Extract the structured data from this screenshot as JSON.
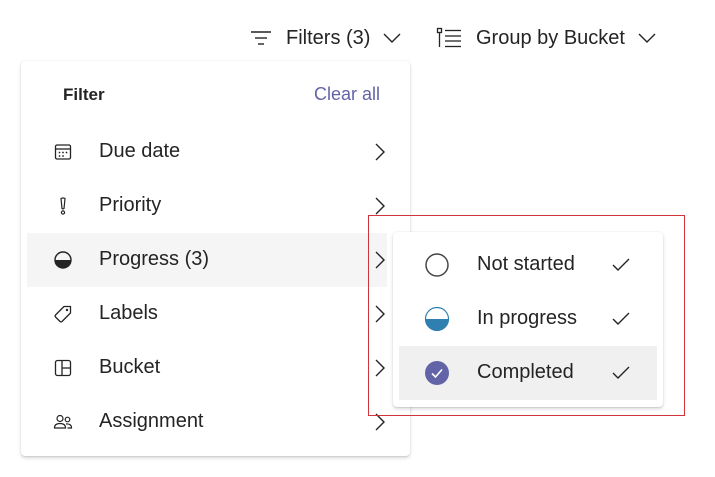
{
  "toolbar": {
    "filters_label": "Filters (3)",
    "group_label": "Group by Bucket"
  },
  "filter_menu": {
    "title": "Filter",
    "clear_all": "Clear all",
    "items": [
      {
        "label": "Due date",
        "icon": "calendar-icon"
      },
      {
        "label": "Priority",
        "icon": "exclamation-icon"
      },
      {
        "label": "Progress (3)",
        "icon": "half-circle-icon",
        "selected": true
      },
      {
        "label": "Labels",
        "icon": "tag-icon"
      },
      {
        "label": "Bucket",
        "icon": "bucket-board-icon"
      },
      {
        "label": "Assignment",
        "icon": "people-icon"
      }
    ]
  },
  "progress_submenu": {
    "items": [
      {
        "label": "Not started",
        "icon": "empty-circle-icon",
        "checked": true
      },
      {
        "label": "In progress",
        "icon": "half-filled-circle-icon",
        "checked": true
      },
      {
        "label": "Completed",
        "icon": "completed-check-circle-icon",
        "checked": true,
        "selected": true
      }
    ]
  },
  "colors": {
    "accent": "#6264a7",
    "in_progress": "#2f7fb0",
    "completed": "#6264a7",
    "highlight_border": "#d13438"
  }
}
